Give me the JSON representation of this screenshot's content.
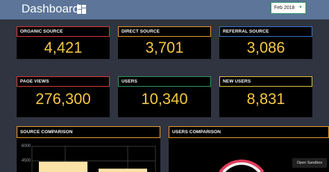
{
  "header": {
    "title": "Dashboard",
    "month_select": {
      "value": "Feb 2018"
    }
  },
  "cards": [
    {
      "label": "ORGANIC SOURCE",
      "value": "4,421",
      "border": "#e03b3b"
    },
    {
      "label": "DIRECT SOURCE",
      "value": "3,701",
      "border": "#f0a030"
    },
    {
      "label": "REFERRAL SOURCE",
      "value": "3,086",
      "border": "#3b78d8"
    },
    {
      "label": "PAGE VIEWS",
      "value": "276,300",
      "border": "#e03b3b"
    },
    {
      "label": "USERS",
      "value": "10,340",
      "border": "#2e9e5e"
    },
    {
      "label": "NEW USERS",
      "value": "8,831",
      "border": "#e8c840"
    }
  ],
  "panels": {
    "source_comparison": {
      "title": "SOURCE COMPARISON",
      "border": "#f0a030"
    },
    "users_comparison": {
      "title": "USERS COMPARISON",
      "border": "#f0a030"
    }
  },
  "chart_data": {
    "type": "bar",
    "title": "SOURCE COMPARISON",
    "yticks": [
      "6000",
      "4500"
    ],
    "ylim": [
      0,
      6000
    ],
    "values": [
      4421,
      3701
    ],
    "bar_color": "#fbe3a7"
  },
  "sandbox": {
    "label": "Open Sandbox"
  }
}
